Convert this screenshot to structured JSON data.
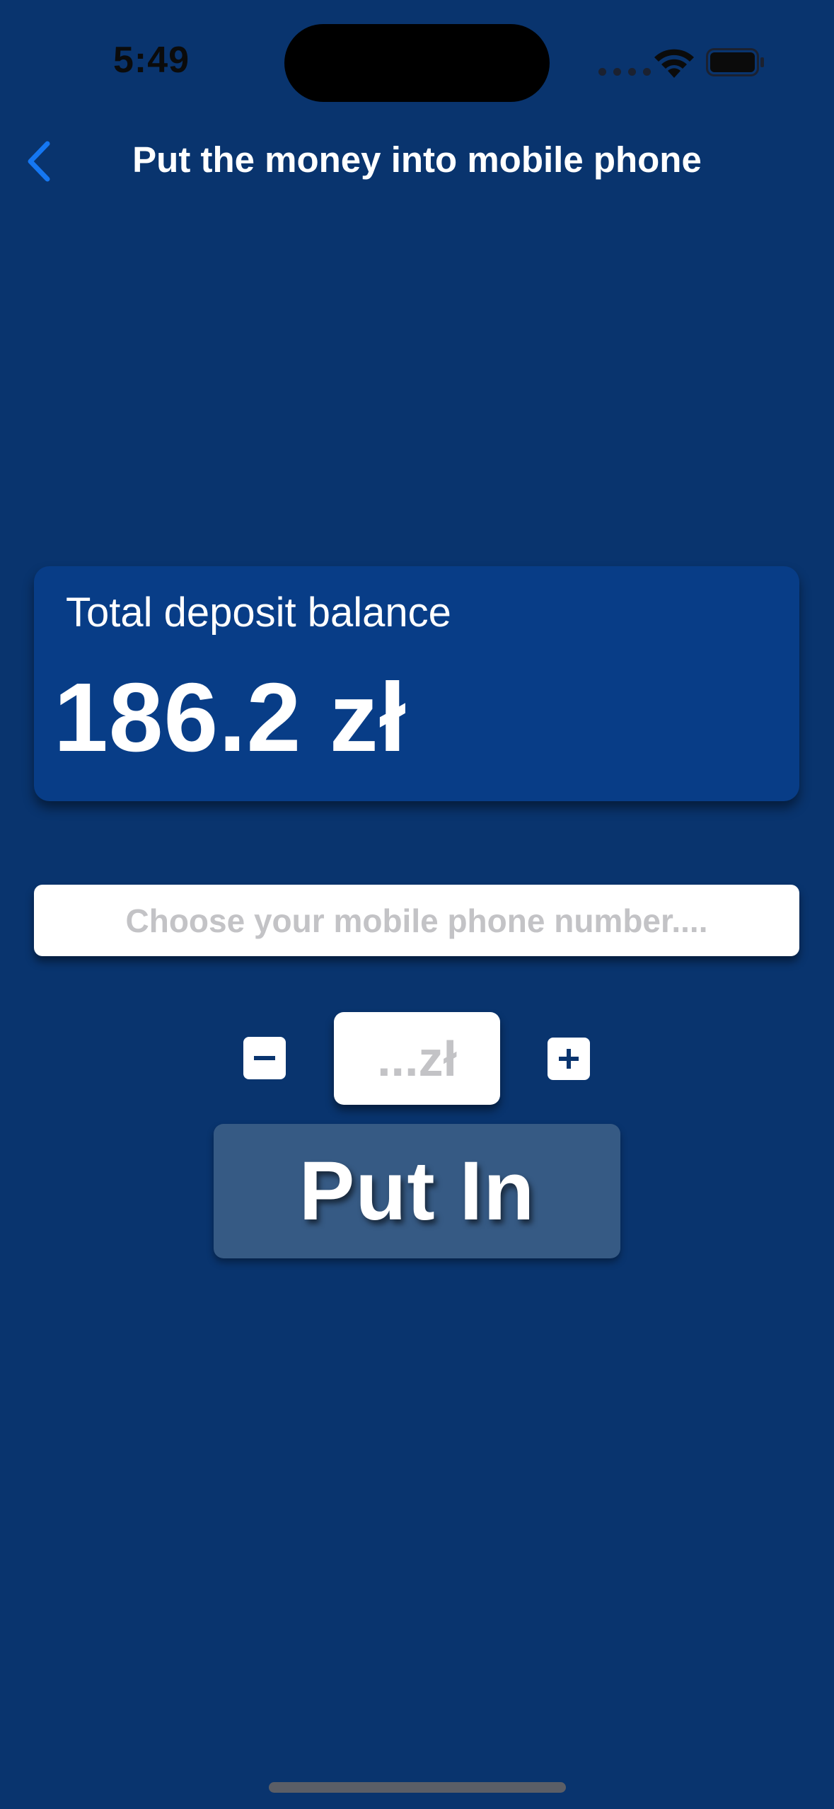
{
  "status_bar": {
    "time": "5:49",
    "icons": [
      "cellular-dots-icon",
      "wifi-icon",
      "battery-icon"
    ]
  },
  "nav": {
    "back_icon": "chevron-left-icon",
    "title": "Put the money into mobile phone"
  },
  "balance": {
    "label": "Total deposit balance",
    "amount": "186.2 zł"
  },
  "phone_picker": {
    "placeholder": "Choose your mobile phone number...."
  },
  "amount": {
    "placeholder": "...zł",
    "decrement_icon": "minus-icon",
    "increment_icon": "plus-icon"
  },
  "actions": {
    "put_in_label": "Put In"
  },
  "colors": {
    "background": "#09346e",
    "card": "#083d87",
    "button": "#365a84",
    "accent_back": "#1577f2",
    "placeholder": "#c3c3c6"
  }
}
